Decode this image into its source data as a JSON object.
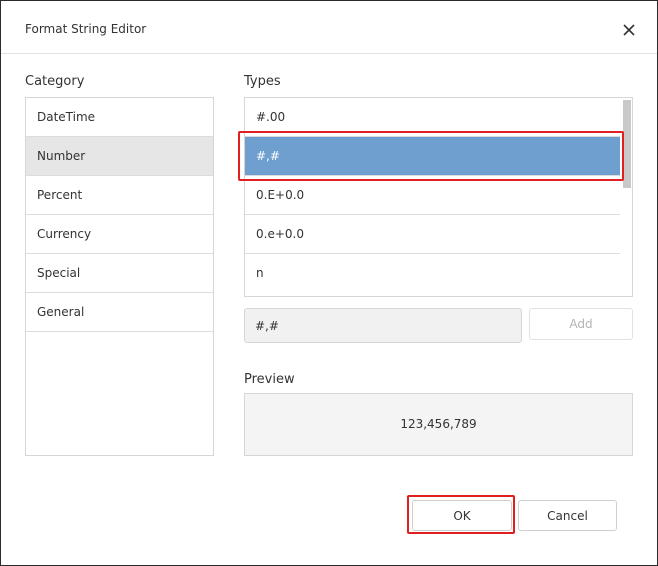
{
  "dialog": {
    "title": "Format String Editor",
    "close_icon": "close-icon"
  },
  "category": {
    "label": "Category",
    "items": [
      {
        "label": "DateTime",
        "selected": false
      },
      {
        "label": "Number",
        "selected": true
      },
      {
        "label": "Percent",
        "selected": false
      },
      {
        "label": "Currency",
        "selected": false
      },
      {
        "label": "Special",
        "selected": false
      },
      {
        "label": "General",
        "selected": false
      }
    ]
  },
  "types": {
    "label": "Types",
    "items": [
      {
        "label": "#.00",
        "selected": false
      },
      {
        "label": "#,#",
        "selected": true
      },
      {
        "label": "0.E+0.0",
        "selected": false
      },
      {
        "label": "0.e+0.0",
        "selected": false
      },
      {
        "label": "n",
        "selected": false
      }
    ]
  },
  "format": {
    "value": "#,#",
    "add_label": "Add"
  },
  "preview": {
    "label": "Preview",
    "value": "123,456,789"
  },
  "buttons": {
    "ok_label": "OK",
    "cancel_label": "Cancel"
  },
  "colors": {
    "selected_type_bg": "#6e9fcf",
    "selected_category_bg": "#e6e6e6",
    "highlight": "#e02020"
  }
}
